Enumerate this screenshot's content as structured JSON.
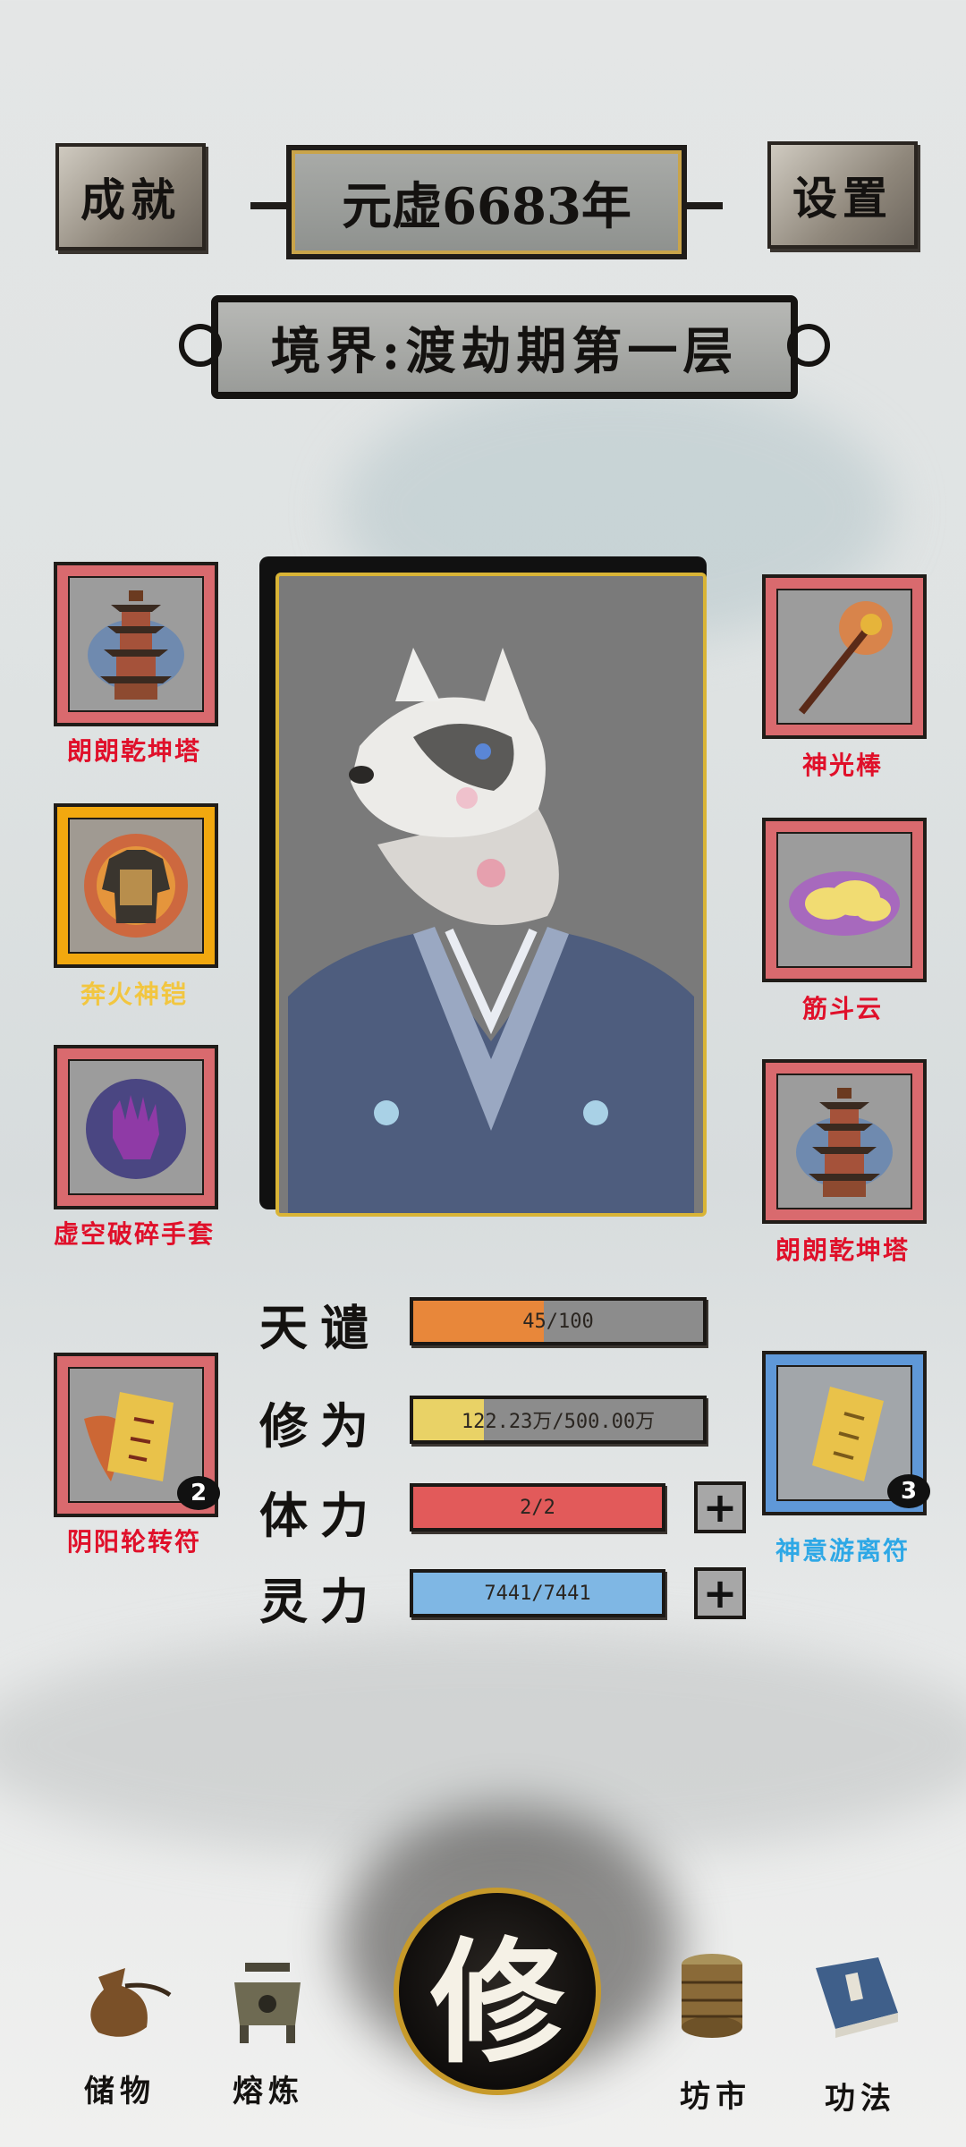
{
  "header": {
    "achievements_label": "成就",
    "settings_label": "设置",
    "year_text": "元虚6683年",
    "realm_text": "境界:渡劫期第一层"
  },
  "equipment": {
    "left": [
      {
        "name": "朗朗乾坤塔",
        "rarity": "red"
      },
      {
        "name": "奔火神铠",
        "rarity": "gold"
      },
      {
        "name": "虚空破碎手套",
        "rarity": "red"
      },
      {
        "name": "阴阳轮转符",
        "rarity": "red",
        "count": "2"
      }
    ],
    "right": [
      {
        "name": "神光棒",
        "rarity": "red"
      },
      {
        "name": "筋斗云",
        "rarity": "red"
      },
      {
        "name": "朗朗乾坤塔",
        "rarity": "red"
      },
      {
        "name": "神意游离符",
        "rarity": "blue",
        "count": "3"
      }
    ]
  },
  "stats": {
    "tribulation": {
      "label": "天谴",
      "text": "45/100",
      "fraction": 0.45,
      "color": "#e8873a"
    },
    "cultivation": {
      "label": "修为",
      "text": "122.23万/500.00万",
      "fraction": 0.244,
      "color": "#e9d266"
    },
    "stamina": {
      "label": "体力",
      "text": "2/2",
      "fraction": 1.0,
      "color": "#e25a5a"
    },
    "spirit": {
      "label": "灵力",
      "text": "7441/7441",
      "fraction": 1.0,
      "color": "#7fb7e4"
    }
  },
  "nav": {
    "storage": "储物",
    "refine": "熔炼",
    "cultivate": "修",
    "market": "坊市",
    "techniques": "功法"
  },
  "colors": {
    "red_frame": "#d96a6e",
    "gold_frame": "#f2a80f",
    "blue_frame": "#5f98d8"
  }
}
